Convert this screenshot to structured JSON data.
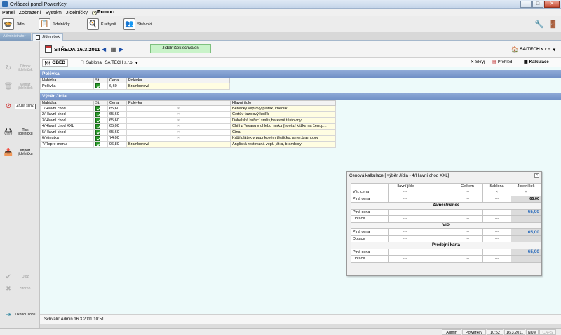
{
  "window": {
    "title": "Ovládací panel PowerKey",
    "controls": [
      "–",
      "□",
      "✕"
    ]
  },
  "menu": [
    "Panel",
    "Zobrazení",
    "Systém",
    "Jídelníčky"
  ],
  "help_menu": "Pomoc",
  "toolbar": {
    "jidlo": "Jídlo",
    "jidelnicky": "Jídelníčky",
    "kuchyne": "Kuchyně",
    "stravnici": "Strávníci"
  },
  "tabs": {
    "admin": "Administrátor",
    "jidelnicek": "Jídelníček"
  },
  "sidebar": {
    "obnov": "Obnov jídelníček",
    "vymaz": "Vymaž jídelníček",
    "zrusit": "Zrušit schv.",
    "tisk": "Tisk jídelníčku",
    "import": "Import jídelníčku",
    "uloz": "Ulož",
    "storno": "Storno",
    "ukonci": "Ukonči úlohu"
  },
  "date_bar": {
    "date": "STŘEDA 16.3.2011",
    "status": "Jídelníček schválen",
    "company": "SAITECH s.r.o."
  },
  "meal_bar": {
    "meal": "OBĚD",
    "sablona_label": "Šablona:",
    "sablona_value": "SAITECH s.r.o.",
    "skryj": "Skryj",
    "prehled": "Přehled",
    "kalkulace": "Kalkulace"
  },
  "polevka": {
    "title": "Polévka",
    "headers": [
      "Nabídka",
      "St.",
      "Cena",
      "Polévka"
    ],
    "rows": [
      {
        "nabidka": "Polévka",
        "cena": "6,60",
        "polevka": "Bramborová"
      }
    ]
  },
  "vyber": {
    "title": "Výběr Jídla",
    "headers": [
      "Nabídka",
      "St.",
      "Cena",
      "Polévka",
      "Hlavní jídlo"
    ],
    "rows": [
      {
        "nabidka": "1/Hlavní chod",
        "cena": "65,60",
        "polevka": "×",
        "hlavni": "Benácký vepřový plátek, knedlík"
      },
      {
        "nabidka": "2/Hlavní chod",
        "cena": "65,60",
        "polevka": "×",
        "hlavni": "Čertův fazolový kotlík"
      },
      {
        "nabidka": "3/Hlavní chod",
        "cena": "65,60",
        "polevka": "×",
        "hlavni": "Ďábelská kuřecí směs,barevné těstoviny"
      },
      {
        "nabidka": "4/Hlavní chod XXL",
        "cena": "65,00",
        "polevka": "×",
        "hlavni": "Chilí z Texasu v chlebu hmku (hovězí kližka na čem.p..."
      },
      {
        "nabidka": "5/Hlavní chod",
        "cena": "65,60",
        "polevka": "×",
        "hlavni": "Čína"
      },
      {
        "nabidka": "6/Minutka",
        "cena": "74,00",
        "polevka": "×",
        "hlavni": "Krůtí plátek v paprikovém těstíčku, amer.brambory"
      },
      {
        "nabidka": "7/Repre menu",
        "cena": "96,80",
        "polevka": "Bramborová",
        "hlavni": "Anglická restovaná vepř. játra, brambory"
      }
    ]
  },
  "kalkulace": {
    "title": "Cenová kalkulace  [ výběr Jídla - 4/Hlavní chod XXL]",
    "headers": [
      "",
      "Hlavní jídlo",
      "",
      "Celkem",
      "Šablona",
      "Jídelníček"
    ],
    "rows": {
      "vyr_cena": "Výr. cena",
      "plna_cena": "Plná cena",
      "dotace": "Dotace",
      "dash": "---",
      "x": "×",
      "value_bold": "65,00",
      "value_blue": "65,00"
    },
    "groups": {
      "zamestnanec": "Zaměstnanec",
      "vip": "VIP",
      "prodejni": "Prodejní karta"
    }
  },
  "saved": "Schválil: Admin 16.3.2011 10:51",
  "statusbar": {
    "user": "Admin",
    "app": "Powerkey",
    "time": "10:52",
    "date": "16.3.2011",
    "num": "NUM",
    "caps": "CAPS"
  }
}
